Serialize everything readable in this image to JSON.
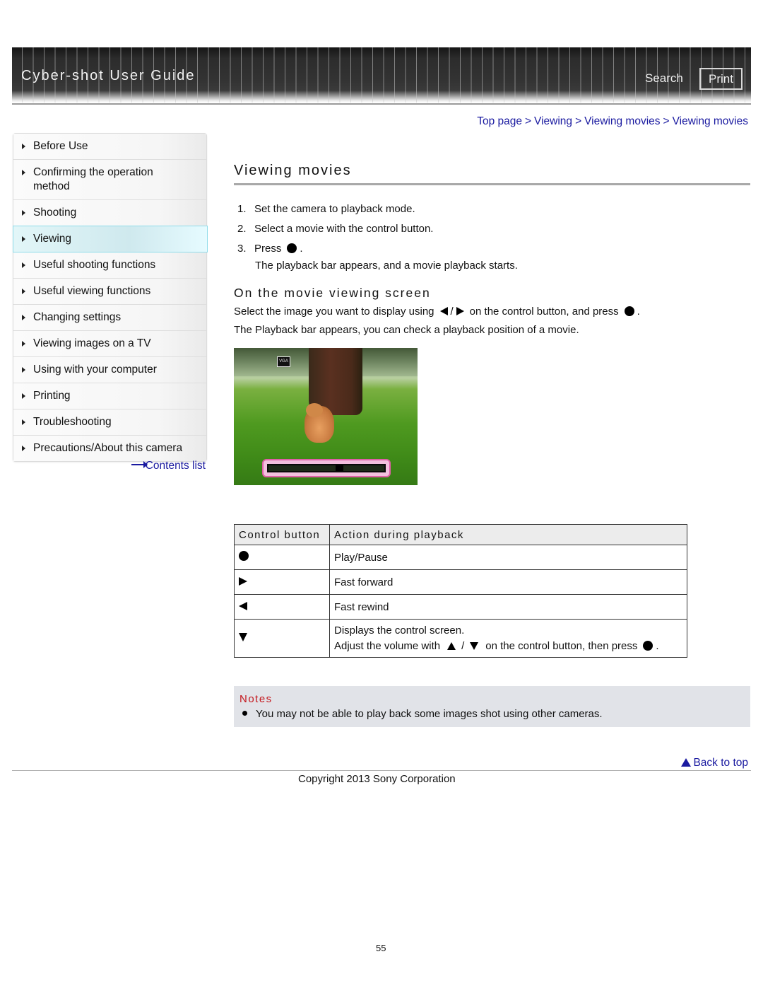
{
  "header": {
    "app_title": "Cyber-shot User Guide",
    "search_label": "Search",
    "print_label": "Print"
  },
  "breadcrumb": {
    "items": [
      "Top page",
      "Viewing",
      "Viewing movies",
      "Viewing movies"
    ],
    "separator": ">"
  },
  "sidebar": {
    "items": [
      {
        "label": "Before Use",
        "active": false
      },
      {
        "label": "Confirming the operation method",
        "active": false
      },
      {
        "label": "Shooting",
        "active": false
      },
      {
        "label": "Viewing",
        "active": true
      },
      {
        "label": "Useful shooting functions",
        "active": false
      },
      {
        "label": "Useful viewing functions",
        "active": false
      },
      {
        "label": "Changing settings",
        "active": false
      },
      {
        "label": "Viewing images on a TV",
        "active": false
      },
      {
        "label": "Using with your computer",
        "active": false
      },
      {
        "label": "Printing",
        "active": false
      },
      {
        "label": "Troubleshooting",
        "active": false
      },
      {
        "label": "Precautions/About this camera",
        "active": false
      }
    ],
    "contents_list_label": "Contents list"
  },
  "main": {
    "title": "Viewing movies",
    "steps": [
      {
        "num": "1.",
        "text": "Set the camera to playback mode."
      },
      {
        "num": "2.",
        "text": "Select a movie with the control button."
      },
      {
        "num": "3.",
        "text": "Press",
        "icon": "center-button-icon",
        "after": ".",
        "sub": "The playback bar appears, and a movie playback starts."
      }
    ],
    "subsection_title": "On the movie viewing screen",
    "para1": {
      "before": "Select the image you want to display using",
      "slash": "/",
      "middle": "on the control button, and press",
      "after": "."
    },
    "para2": "The Playback bar appears, you can check a playback position of a movie.",
    "image": {
      "description": "Movie playback screen showing a cat in grass with playback bar",
      "badge_text": "VGA",
      "playback_position_fraction": 0.62
    },
    "table": {
      "headers": [
        "Control button",
        "Action during playback"
      ],
      "rows": [
        {
          "icon": "center-button-icon",
          "action": "Play/Pause"
        },
        {
          "icon": "right-arrow-icon",
          "action": "Fast forward"
        },
        {
          "icon": "left-arrow-icon",
          "action": "Fast rewind"
        },
        {
          "icon": "down-arrow-icon",
          "action": "Displays the control screen.",
          "action2_before": "Adjust the volume with",
          "action2_slash": "/",
          "action2_middle": "on the control button, then press",
          "action2_after": "."
        }
      ]
    },
    "notes": {
      "title": "Notes",
      "items": [
        "You may not be able to play back some images shot using other cameras."
      ]
    }
  },
  "footer": {
    "back_to_top": "Back to top",
    "copyright": "Copyright 2013 Sony Corporation",
    "page_number": "55"
  },
  "colors": {
    "link": "#1a1aa0",
    "notes_title": "#c4161c",
    "notes_bg": "#e1e3e8",
    "active_nav_border": "#8fdcea"
  }
}
